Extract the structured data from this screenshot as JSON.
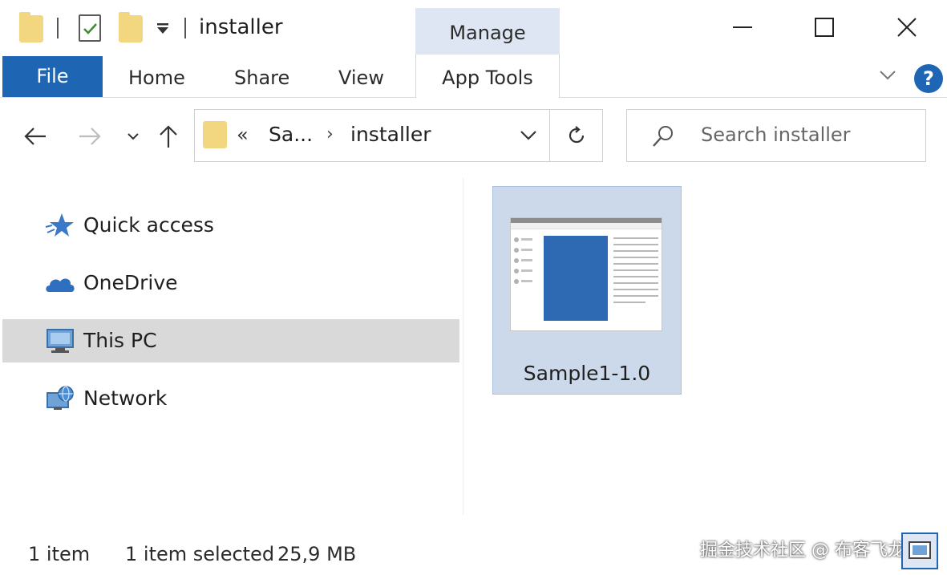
{
  "window": {
    "title": "installer",
    "contextual_group": "Manage"
  },
  "ribbon": {
    "tabs": [
      {
        "label": "File"
      },
      {
        "label": "Home"
      },
      {
        "label": "Share"
      },
      {
        "label": "View"
      },
      {
        "label": "App Tools"
      }
    ],
    "help_label": "?"
  },
  "address_bar": {
    "overflow": "«",
    "segments": [
      "Sa...",
      "installer"
    ],
    "separator": "›"
  },
  "search": {
    "placeholder": "Search installer"
  },
  "sidebar": {
    "items": [
      {
        "label": "Quick access",
        "icon": "star-icon",
        "selected": false
      },
      {
        "label": "OneDrive",
        "icon": "cloud-icon",
        "selected": false
      },
      {
        "label": "This PC",
        "icon": "computer-icon",
        "selected": true
      },
      {
        "label": "Network",
        "icon": "network-icon",
        "selected": false
      }
    ]
  },
  "content": {
    "items": [
      {
        "name": "Sample1-1.0",
        "selected": true
      }
    ]
  },
  "status": {
    "item_count": "1 item",
    "selection": "1 item selected",
    "size": "25,9 MB"
  },
  "watermark": "掘金技术社区 @ 布客飞龙",
  "colors": {
    "accent": "#1e66b4",
    "folder": "#f3d680",
    "selection": "#ccd9ea",
    "contextual_tab": "#dde6f2"
  }
}
